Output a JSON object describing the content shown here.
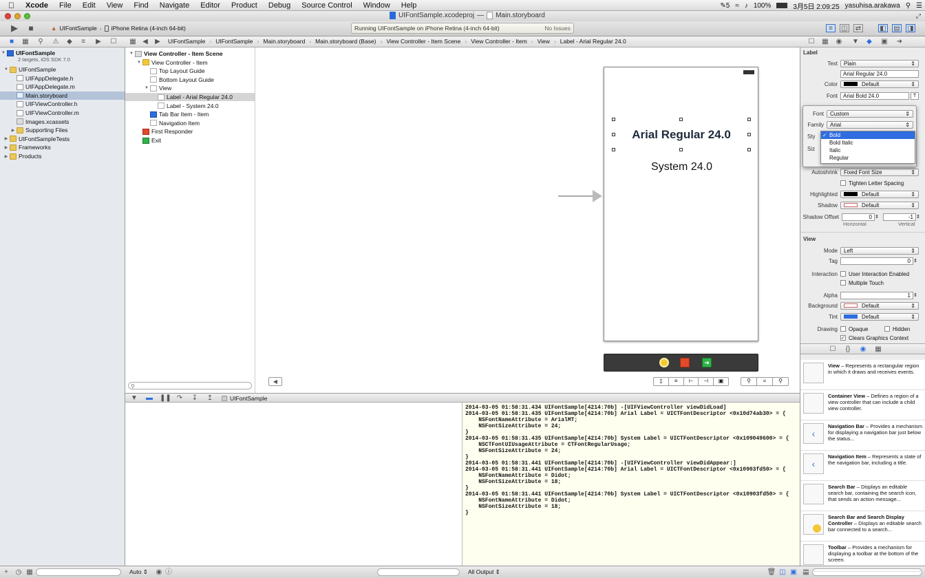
{
  "menubar": {
    "items": [
      "Xcode",
      "File",
      "Edit",
      "View",
      "Find",
      "Navigate",
      "Editor",
      "Product",
      "Debug",
      "Source Control",
      "Window",
      "Help"
    ],
    "status": {
      "battery": "100%",
      "date_time": "3月5日 2:09:25",
      "user": "yasuhisa.arakawa",
      "badge": "5"
    }
  },
  "window": {
    "title": "UIFontSample.xcodeproj",
    "separator": "—",
    "document": "Main.storyboard"
  },
  "toolbar": {
    "scheme": "UIFontSample",
    "destination": "iPhone Retina (4-inch 64-bit)",
    "activity": "Running UIFontSample on iPhone Retina (4-inch 64-bit)",
    "issues": "No Issues"
  },
  "jumpbar": [
    "UIFontSample",
    "UIFontSample",
    "Main.storyboard",
    "Main.storyboard (Base)",
    "View Controller - Item Scene",
    "View Controller - Item",
    "View",
    "Label - Arial Regular 24.0"
  ],
  "navigator": {
    "project": "UIFontSample",
    "project_sub": "2 targets, iOS SDK 7.0",
    "items": [
      {
        "label": "UIFontSample",
        "kind": "folder",
        "indent": 1,
        "open": true
      },
      {
        "label": "UIFAppDelegate.h",
        "kind": "h",
        "indent": 2
      },
      {
        "label": "UIFAppDelegate.m",
        "kind": "m",
        "indent": 2
      },
      {
        "label": "Main.storyboard",
        "kind": "sb",
        "indent": 2,
        "selected": true
      },
      {
        "label": "UIFViewController.h",
        "kind": "h",
        "indent": 2
      },
      {
        "label": "UIFViewController.m",
        "kind": "m",
        "indent": 2
      },
      {
        "label": "Images.xcassets",
        "kind": "xc",
        "indent": 2
      },
      {
        "label": "Supporting Files",
        "kind": "folder",
        "indent": 2,
        "closed": true
      },
      {
        "label": "UIFontSampleTests",
        "kind": "folder",
        "indent": 1,
        "closed": true
      },
      {
        "label": "Frameworks",
        "kind": "folder",
        "indent": 1,
        "closed": true
      },
      {
        "label": "Products",
        "kind": "folder",
        "indent": 1,
        "closed": true
      }
    ]
  },
  "outline": [
    {
      "label": "View Controller - Item Scene",
      "bold": true,
      "indent": 0
    },
    {
      "label": "View Controller - Item",
      "indent": 1
    },
    {
      "label": "Top Layout Guide",
      "indent": 2
    },
    {
      "label": "Bottom Layout Guide",
      "indent": 2
    },
    {
      "label": "View",
      "indent": 2
    },
    {
      "label": "Label - Arial Regular 24.0",
      "indent": 3,
      "selected": true
    },
    {
      "label": "Label - System 24.0",
      "indent": 3
    },
    {
      "label": "Tab Bar Item - Item",
      "indent": 2
    },
    {
      "label": "Navigation Item",
      "indent": 2
    },
    {
      "label": "First Responder",
      "indent": 1
    },
    {
      "label": "Exit",
      "indent": 1
    }
  ],
  "canvas": {
    "label1": "Arial Regular 24.0",
    "label2": "System 24.0"
  },
  "debug": {
    "target": "UIFontSample",
    "auto": "Auto ⇕",
    "output": "All Output ⇕"
  },
  "console_lines": [
    "2014-03-05 01:58:31.434 UIFontSample[4214:70b] -[UIFViewController viewDidLoad]",
    "2014-03-05 01:58:31.435 UIFontSample[4214:70b] Arial Label = UICTFontDescriptor <0x10d74ab30> = {",
    "    NSFontNameAttribute = ArialMT;",
    "    NSFontSizeAttribute = 24;",
    "}",
    "2014-03-05 01:58:31.435 UIFontSample[4214:70b] System Label = UICTFontDescriptor <0x109049600> = {",
    "    NSCTFontUIUsageAttribute = CTFontRegularUsage;",
    "    NSFontSizeAttribute = 24;",
    "}",
    "2014-03-05 01:58:31.441 UIFontSample[4214:70b] -[UIFViewController viewDidAppear:]",
    "2014-03-05 01:58:31.441 UIFontSample[4214:70b] Arial Label = UICTFontDescriptor <0x10903fd50> = {",
    "    NSFontNameAttribute = Didot;",
    "    NSFontSizeAttribute = 18;",
    "}",
    "2014-03-05 01:58:31.441 UIFontSample[4214:70b] System Label = UICTFontDescriptor <0x10903fd50> = {",
    "    NSFontNameAttribute = Didot;",
    "    NSFontSizeAttribute = 18;",
    "}"
  ],
  "inspector": {
    "label_section": "Label",
    "text_label": "Text",
    "text_value": "Plain",
    "text_content": "Arial Regular 24.0",
    "color_label": "Color",
    "color_value": "Default",
    "font_label": "Font",
    "font_value": "Arial Bold 24.0",
    "autoshrink_label": "Autoshrink",
    "autoshrink_value": "Fixed Font Size",
    "tighten": "Tighten Letter Spacing",
    "highlighted_label": "Highlighted",
    "highlighted_value": "Default",
    "shadow_label": "Shadow",
    "shadow_value": "Default",
    "shadow_offset_label": "Shadow Offset",
    "shadow_h": "0",
    "shadow_v": "-1",
    "horizontal": "Horizontal",
    "vertical": "Vertical",
    "view_section": "View",
    "mode_label": "Mode",
    "mode_value": "Left",
    "tag_label": "Tag",
    "tag_value": "0",
    "interaction_label": "Interaction",
    "user_interaction": "User Interaction Enabled",
    "multiple_touch": "Multiple Touch",
    "alpha_label": "Alpha",
    "alpha_value": "1",
    "background_label": "Background",
    "background_value": "Default",
    "tint_label": "Tint",
    "tint_value": "Default",
    "drawing_label": "Drawing",
    "opaque": "Opaque",
    "hidden": "Hidden",
    "clears": "Clears Graphics Context"
  },
  "font_popover": {
    "font_label": "Font",
    "font_value": "Custom",
    "family_label": "Family",
    "family_value": "Arial",
    "style_label": "Sty",
    "size_label": "Siz",
    "styles": [
      "Bold",
      "Bold Italic",
      "Italic",
      "Regular"
    ],
    "selected_style": "Bold"
  },
  "library": [
    {
      "title": "View",
      "desc": " – Represents a rectangular region in which it draws and receives events."
    },
    {
      "title": "Container View",
      "desc": " – Defines a region of a view controller that can include a child view controller."
    },
    {
      "title": "Navigation Bar",
      "desc": " – Provides a mechanism for displaying a navigation bar just below the status..."
    },
    {
      "title": "Navigation Item",
      "desc": " – Represents a state of the navigation bar, including a title."
    },
    {
      "title": "Search Bar",
      "desc": " – Displays an editable search bar, containing the search icon, that sends an action message..."
    },
    {
      "title": "Search Bar and Search Display Controller",
      "desc": " – Displays an editable search bar connected to a search..."
    },
    {
      "title": "Toolbar",
      "desc": " – Provides a mechanism for displaying a toolbar at the bottom of the screen."
    }
  ],
  "colors": {
    "selection": "#b3c3d9",
    "accent": "#2f6de0",
    "console_bg": "#fffff0"
  }
}
